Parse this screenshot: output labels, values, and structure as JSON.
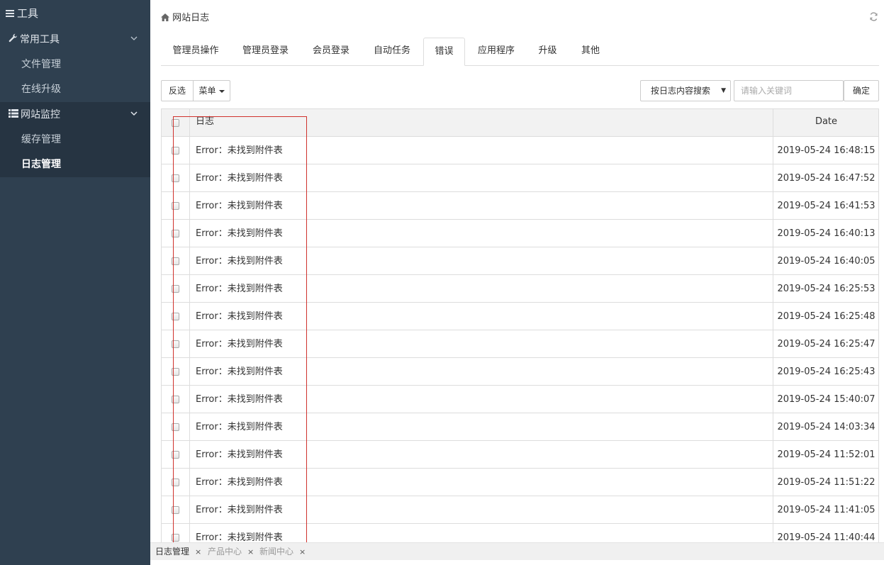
{
  "sidebar": {
    "title": "工具",
    "groups": [
      {
        "label": "常用工具",
        "items": [
          "文件管理",
          "在线升级"
        ]
      },
      {
        "label": "网站监控",
        "items": [
          "缓存管理",
          "日志管理"
        ]
      }
    ]
  },
  "header": {
    "breadcrumb": "网站日志"
  },
  "tabs": [
    "管理员操作",
    "管理员登录",
    "会员登录",
    "自动任务",
    "错误",
    "应用程序",
    "升级",
    "其他"
  ],
  "toolbar": {
    "invert_label": "反选",
    "menu_label": "菜单",
    "search_select": "按日志内容搜索",
    "search_placeholder": "请输入关键词",
    "confirm_label": "确定"
  },
  "table": {
    "columns": [
      "日志",
      "Date"
    ],
    "rows": [
      {
        "log": "Error：未找到附件表",
        "date": "2019-05-24 16:48:15"
      },
      {
        "log": "Error：未找到附件表",
        "date": "2019-05-24 16:47:52"
      },
      {
        "log": "Error：未找到附件表",
        "date": "2019-05-24 16:41:53"
      },
      {
        "log": "Error：未找到附件表",
        "date": "2019-05-24 16:40:13"
      },
      {
        "log": "Error：未找到附件表",
        "date": "2019-05-24 16:40:05"
      },
      {
        "log": "Error：未找到附件表",
        "date": "2019-05-24 16:25:53"
      },
      {
        "log": "Error：未找到附件表",
        "date": "2019-05-24 16:25:48"
      },
      {
        "log": "Error：未找到附件表",
        "date": "2019-05-24 16:25:47"
      },
      {
        "log": "Error：未找到附件表",
        "date": "2019-05-24 16:25:43"
      },
      {
        "log": "Error：未找到附件表",
        "date": "2019-05-24 15:40:07"
      },
      {
        "log": "Error：未找到附件表",
        "date": "2019-05-24 14:03:34"
      },
      {
        "log": "Error：未找到附件表",
        "date": "2019-05-24 11:52:01"
      },
      {
        "log": "Error：未找到附件表",
        "date": "2019-05-24 11:51:22"
      },
      {
        "log": "Error：未找到附件表",
        "date": "2019-05-24 11:41:05"
      },
      {
        "log": "Error：未找到附件表",
        "date": "2019-05-24 11:40:44"
      }
    ]
  },
  "bottom_tabs": [
    "日志管理",
    "产品中心",
    "新闻中心"
  ],
  "colors": {
    "sidebar_bg": "#2f4050",
    "highlight": "#d0312d"
  }
}
